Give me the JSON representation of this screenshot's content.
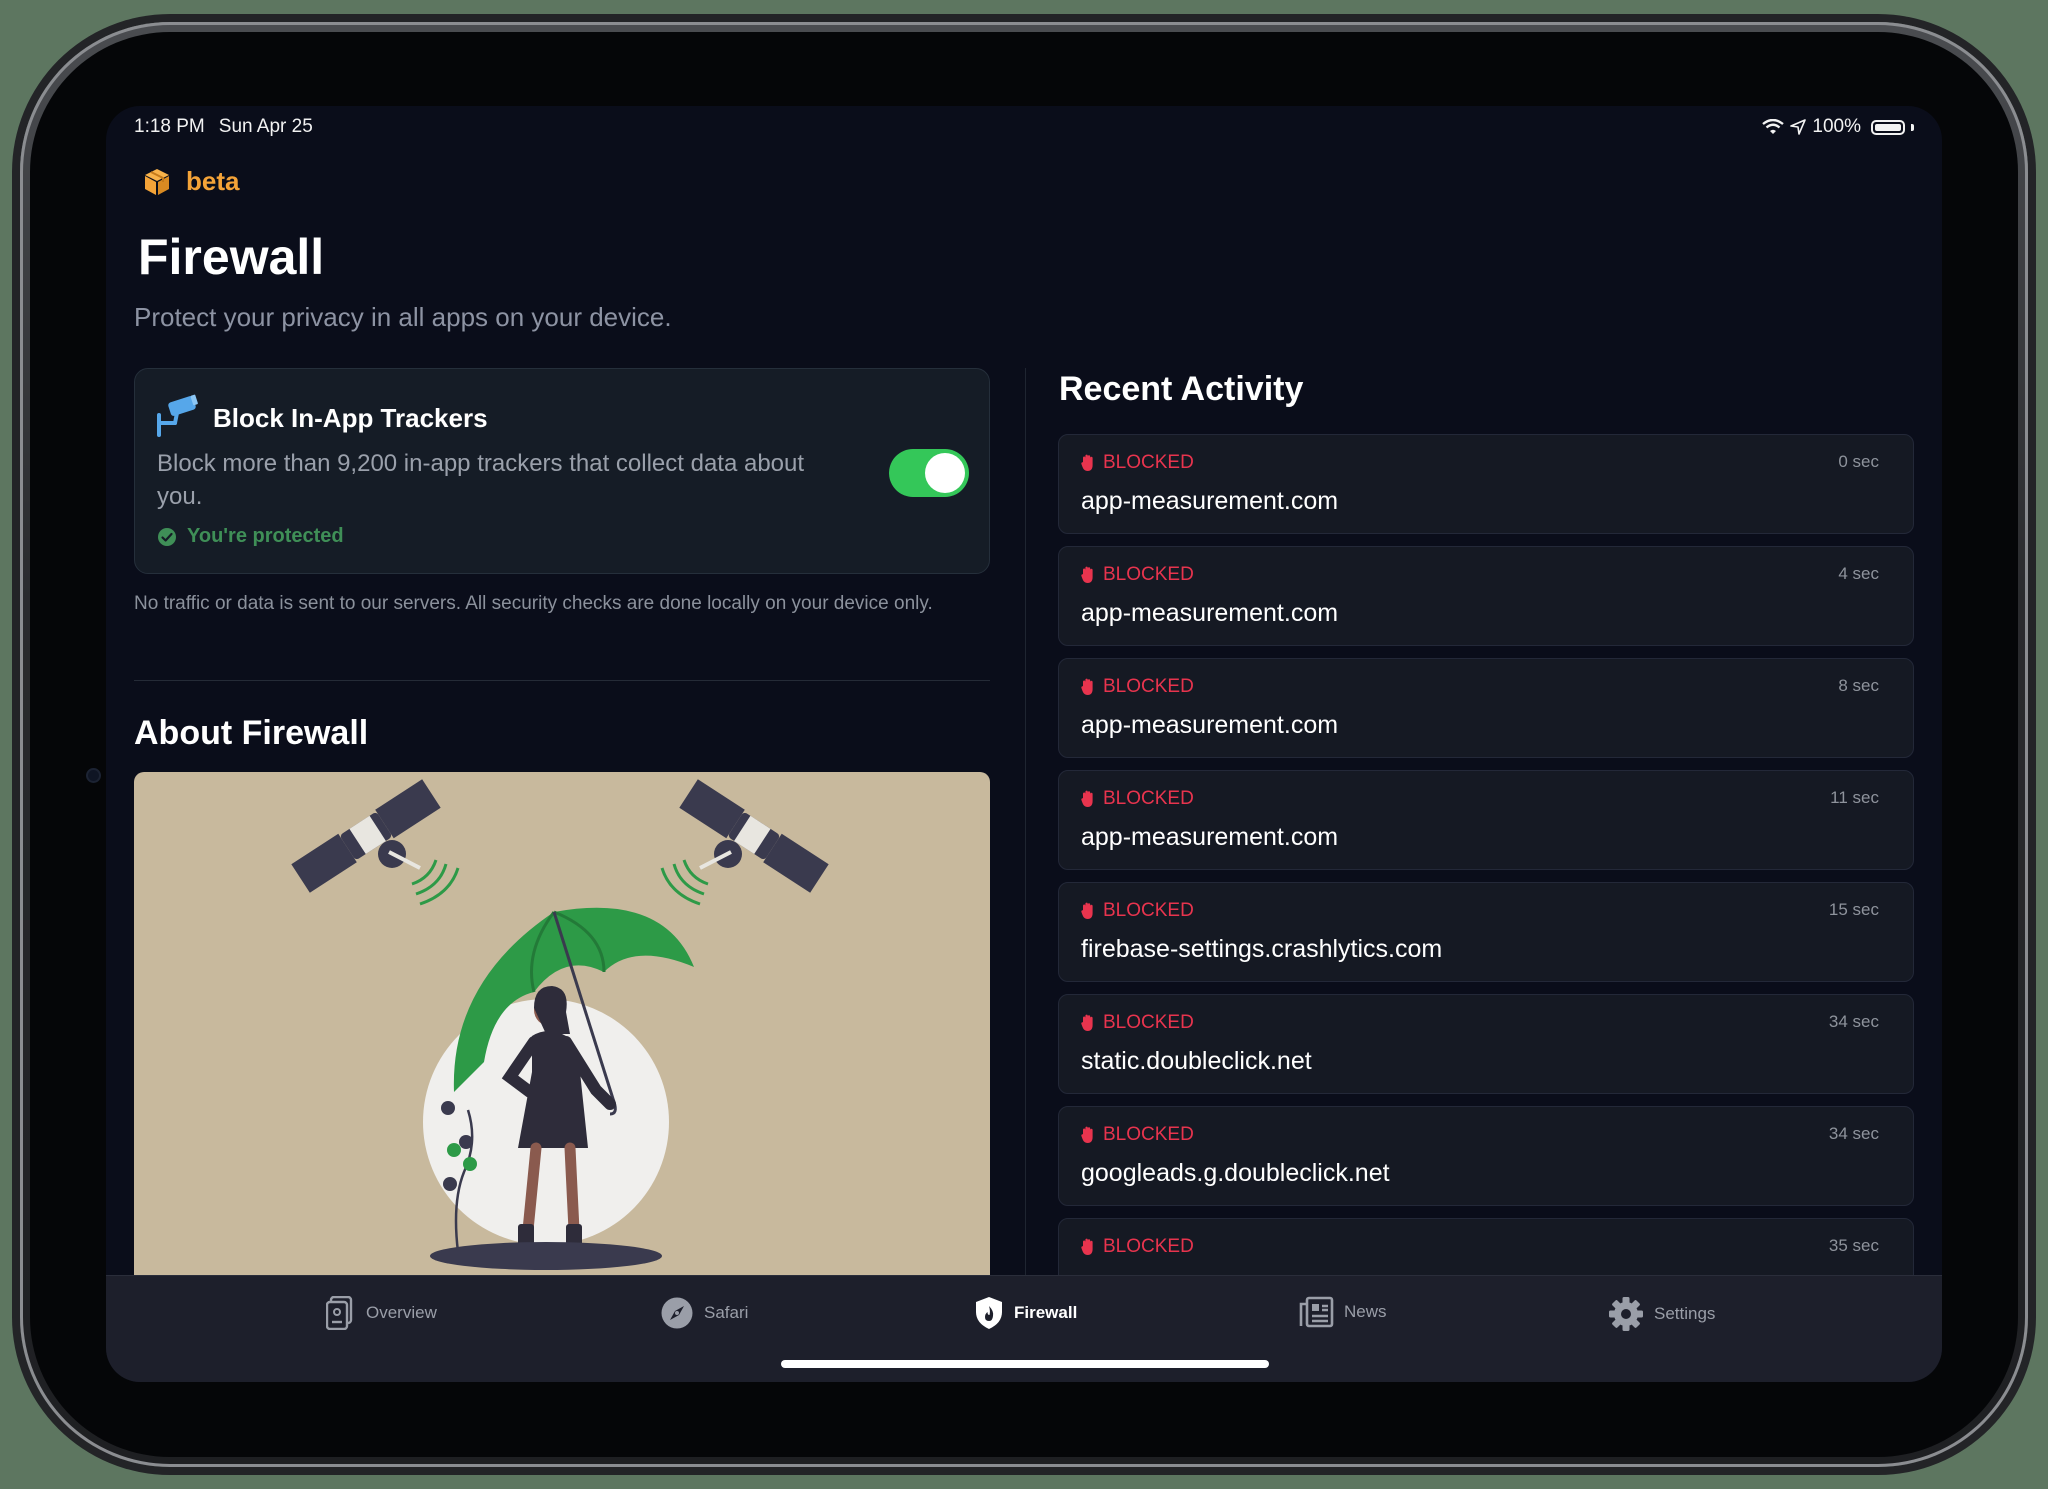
{
  "status_bar": {
    "time": "1:18 PM",
    "date": "Sun Apr 25",
    "battery": "100%"
  },
  "header": {
    "badge": "beta",
    "title": "Firewall",
    "subtitle": "Protect your privacy in all apps on your device."
  },
  "tracker_card": {
    "title": "Block In-App Trackers",
    "description": "Block more than 9,200 in-app trackers that collect data about you.",
    "status": "You're protected",
    "enabled": true
  },
  "privacy_note": "No traffic or data is sent to our servers. All security checks are done locally on your device only.",
  "about": {
    "title": "About Firewall"
  },
  "recent": {
    "title": "Recent Activity",
    "items": [
      {
        "status": "BLOCKED",
        "time": "0 sec",
        "domain": "app-measurement.com"
      },
      {
        "status": "BLOCKED",
        "time": "4 sec",
        "domain": "app-measurement.com"
      },
      {
        "status": "BLOCKED",
        "time": "8 sec",
        "domain": "app-measurement.com"
      },
      {
        "status": "BLOCKED",
        "time": "11 sec",
        "domain": "app-measurement.com"
      },
      {
        "status": "BLOCKED",
        "time": "15 sec",
        "domain": "firebase-settings.crashlytics.com"
      },
      {
        "status": "BLOCKED",
        "time": "34 sec",
        "domain": "static.doubleclick.net"
      },
      {
        "status": "BLOCKED",
        "time": "34 sec",
        "domain": "googleads.g.doubleclick.net"
      },
      {
        "status": "BLOCKED",
        "time": "35 sec",
        "domain": ""
      }
    ]
  },
  "tabs": [
    {
      "label": "Overview",
      "icon": "overview-icon"
    },
    {
      "label": "Safari",
      "icon": "compass-icon"
    },
    {
      "label": "Firewall",
      "icon": "shield-flame-icon",
      "active": true
    },
    {
      "label": "News",
      "icon": "newspaper-icon"
    },
    {
      "label": "Settings",
      "icon": "gear-icon"
    }
  ],
  "colors": {
    "accent_orange": "#f4a338",
    "toggle_green": "#34c759",
    "blocked_red": "#e8344e",
    "protected_green": "#3f8f57"
  }
}
